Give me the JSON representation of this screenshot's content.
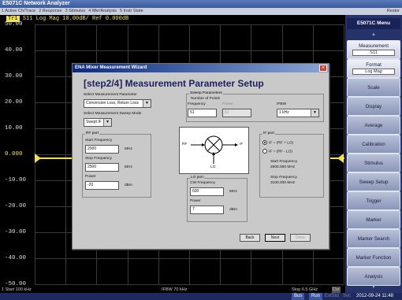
{
  "app": {
    "title": "E5071C Network Analyzer"
  },
  "menu": {
    "items": [
      "1 Active Ch/Trace",
      "2 Response",
      "3 Stimulus",
      "4 Mkr/Analysis",
      "5 Instr State"
    ],
    "right": "Restor"
  },
  "trace_header": {
    "tag": "Tr1",
    "text": "S11 Log Mag 10.00dB/ Ref 0.000dB"
  },
  "y_axis": {
    "labels": [
      "50.00",
      "40.00",
      "30.00",
      "20.00",
      "10.00",
      "0.000",
      "-10.00",
      "-20.00",
      "-30.00",
      "-40.00",
      "-50.00"
    ]
  },
  "chart_data": {
    "type": "line",
    "series": [
      {
        "name": "S11",
        "values": [
          0,
          0
        ]
      }
    ],
    "x": [
      0,
      1
    ],
    "ylim": [
      -50,
      50
    ]
  },
  "status": {
    "start": "1  Start 100 kHz",
    "ifbw": "IFBW 70 kHz",
    "stop": "Stop 6.5 GHz",
    "stop_tag": "Cor"
  },
  "bottom": {
    "bus": "Bus",
    "run": "Run",
    "extra": "ExtStd",
    "svc": "Svc",
    "datetime": "2012-09-24 11:48"
  },
  "softkeys": {
    "title": "E5071C Menu",
    "items": [
      {
        "label": "Measurement",
        "sub": "S11"
      },
      {
        "label": "Format",
        "sub": "Log Mag"
      },
      {
        "label": "Scale"
      },
      {
        "label": "Display"
      },
      {
        "label": "Average"
      },
      {
        "label": "Calibration"
      },
      {
        "label": "Stimulus"
      },
      {
        "label": "Sweep Setup"
      },
      {
        "label": "Trigger"
      },
      {
        "label": "Marker"
      },
      {
        "label": "Marker Search"
      },
      {
        "label": "Marker Function"
      },
      {
        "label": "Analysis"
      }
    ]
  },
  "dialog": {
    "title": "ENA Mixer Measurement Wizard",
    "heading": "[step2/4] Measurement Parameter Setup",
    "select_param_label": "Select Measurement Parameter",
    "select_param_value": "Conversion Loss, Return Loss",
    "sweep_mode_label": "Select Measurement Sweep Mode",
    "sweep_mode_value": "Swept IF",
    "sweep_params": {
      "title": "Sweep Parameters",
      "points_label": "Number of Points",
      "freq_label": "Frequency",
      "freq_value": "51",
      "power_label": "Power",
      "power_value": "51",
      "ifbw_label": "IFBW",
      "ifbw_value": "1 kHz"
    },
    "rf_port": {
      "title": "RF port",
      "start_label": "Start Frequency",
      "start_value": "2000",
      "start_unit": "MHz",
      "stop_label": "Stop Frequency",
      "stop_value": "2500",
      "stop_unit": "MHz",
      "power_label": "Power",
      "power_value": "-20",
      "power_unit": "dBm"
    },
    "lo_port": {
      "title": "LO port",
      "cw_label": "CW Frequency",
      "cw_value": "600",
      "cw_unit": "MHz",
      "power_label": "Power",
      "power_value": "7",
      "power_unit": "dBm"
    },
    "if_port": {
      "title": "IF port",
      "opt1": "IF = (RF + LO)",
      "opt2": "IF = (RF - LO)",
      "start_label": "Start Frequency",
      "start_value": "2600.000 MHz",
      "stop_label": "Stop Frequency",
      "stop_value": "3100.000 MHz"
    },
    "diagram": {
      "rf": "RF",
      "if": "IF",
      "lo": "LO"
    },
    "buttons": {
      "back": "Back",
      "next": "Next",
      "done": "Done"
    }
  }
}
